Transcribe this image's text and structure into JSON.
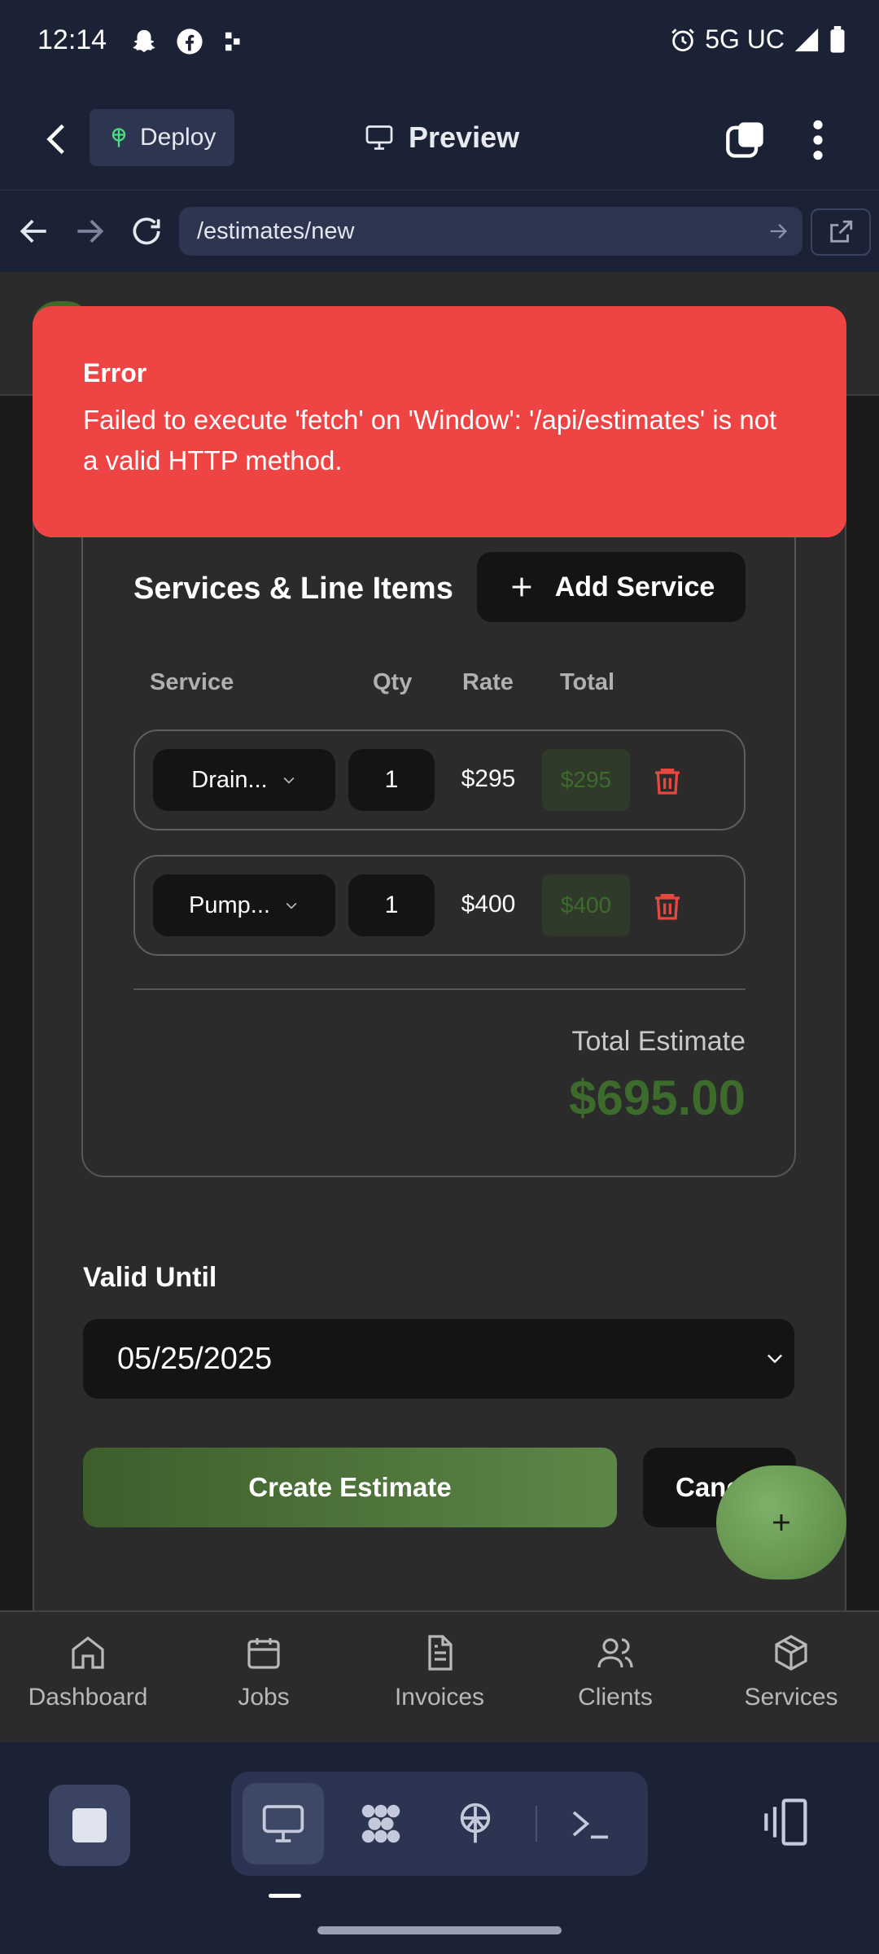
{
  "status_bar": {
    "time": "12:14",
    "network": "5G UC"
  },
  "app_bar": {
    "deploy_label": "Deploy",
    "preview_label": "Preview"
  },
  "browser": {
    "url": "/estimates/new"
  },
  "error_toast": {
    "title": "Error",
    "message": "Failed to execute 'fetch' on 'Window': '/api/estimates' is not a valid HTTP method."
  },
  "services_card": {
    "title": "Services & Line Items",
    "add_button": "Add Service",
    "columns": {
      "service": "Service",
      "qty": "Qty",
      "rate": "Rate",
      "total": "Total"
    },
    "rows": [
      {
        "service": "Drain...",
        "qty": "1",
        "rate": "$295",
        "total": "$295"
      },
      {
        "service": "Pump...",
        "qty": "1",
        "rate": "$400",
        "total": "$400"
      }
    ],
    "total_label": "Total Estimate",
    "total_amount": "$695.00"
  },
  "valid_until": {
    "label": "Valid Until",
    "value": "05/25/2025"
  },
  "actions": {
    "create": "Create Estimate",
    "cancel": "Cancel"
  },
  "bottom_nav": [
    {
      "label": "Dashboard",
      "icon": "home-icon"
    },
    {
      "label": "Jobs",
      "icon": "calendar-icon"
    },
    {
      "label": "Invoices",
      "icon": "document-icon"
    },
    {
      "label": "Clients",
      "icon": "users-icon"
    },
    {
      "label": "Services",
      "icon": "package-icon"
    }
  ],
  "colors": {
    "error": "#ef4444",
    "accent_green": "#5d8747",
    "total_green": "#3d6b2c",
    "trash_red": "#e5483e"
  }
}
